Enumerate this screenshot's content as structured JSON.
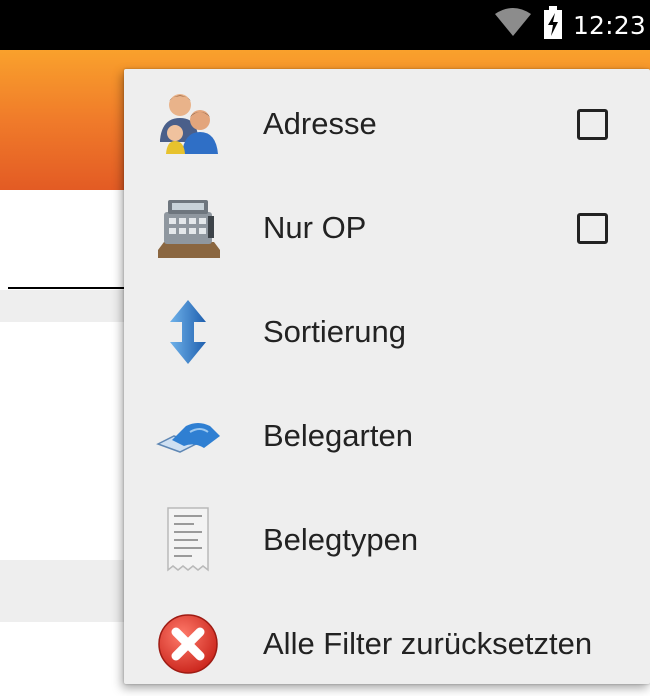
{
  "status_bar": {
    "time": "12:23",
    "icons": [
      "wifi-icon",
      "battery-charging-icon"
    ]
  },
  "colors": {
    "toolbar_top": "#f9a12c",
    "toolbar_bottom": "#e35b24",
    "menu_background": "#eeeeee",
    "text": "#222222"
  },
  "menu": {
    "items": [
      {
        "label": "Adresse",
        "icon": "people-icon",
        "checkbox": true,
        "checked": false
      },
      {
        "label": "Nur OP",
        "icon": "cash-register-icon",
        "checkbox": true,
        "checked": false
      },
      {
        "label": "Sortierung",
        "icon": "sort-arrows-icon",
        "checkbox": false
      },
      {
        "label": "Belegarten",
        "icon": "document-types-icon",
        "checkbox": false
      },
      {
        "label": "Belegtypen",
        "icon": "receipt-icon",
        "checkbox": false
      },
      {
        "label": "Alle Filter zurücksetzten",
        "icon": "reset-cross-icon",
        "checkbox": false
      }
    ]
  }
}
